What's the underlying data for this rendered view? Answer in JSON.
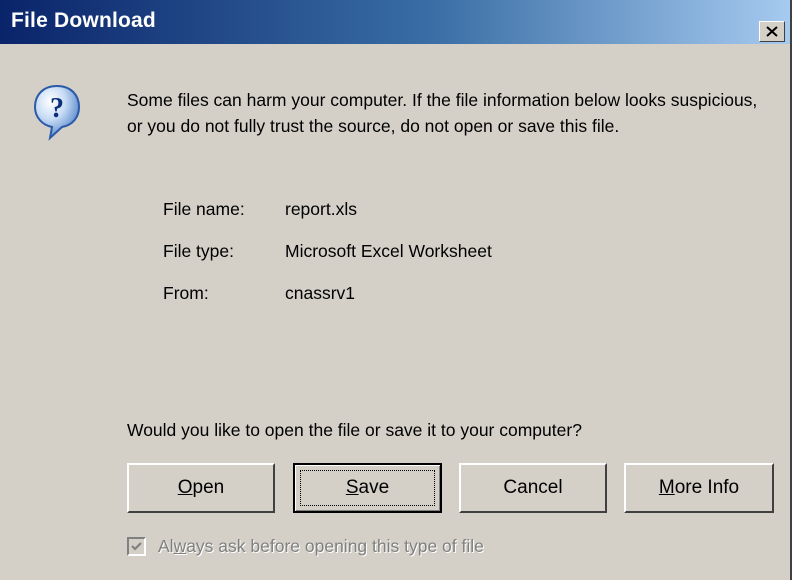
{
  "window": {
    "title": "File Download"
  },
  "message": "Some files can harm your computer. If the file information below looks suspicious, or you do not fully trust the source, do not open or save this file.",
  "file_info": {
    "name_label": "File name:",
    "name_value": "report.xls",
    "type_label": "File type:",
    "type_value": "Microsoft Excel Worksheet",
    "from_label": "From:",
    "from_value": "cnassrv1"
  },
  "question": "Would you like to open the file or save it to your computer?",
  "buttons": {
    "open_accel": "O",
    "open_rest": "pen",
    "save_accel": "S",
    "save_rest": "ave",
    "cancel": "Cancel",
    "more_info_accel": "M",
    "more_info_rest": "ore Info"
  },
  "checkbox": {
    "label_start": "Al",
    "label_accel": "w",
    "label_rest": "ays ask before opening this type of file",
    "checked": true,
    "disabled": true
  },
  "colors": {
    "dialog_bg": "#d4d0c8",
    "title_gradient_start": "#0a246a",
    "title_gradient_end": "#a6caf0",
    "disabled_text": "#808080"
  },
  "icons": {
    "dialog": "question-help-icon",
    "close": "close-x-icon",
    "check": "checkmark-icon"
  }
}
